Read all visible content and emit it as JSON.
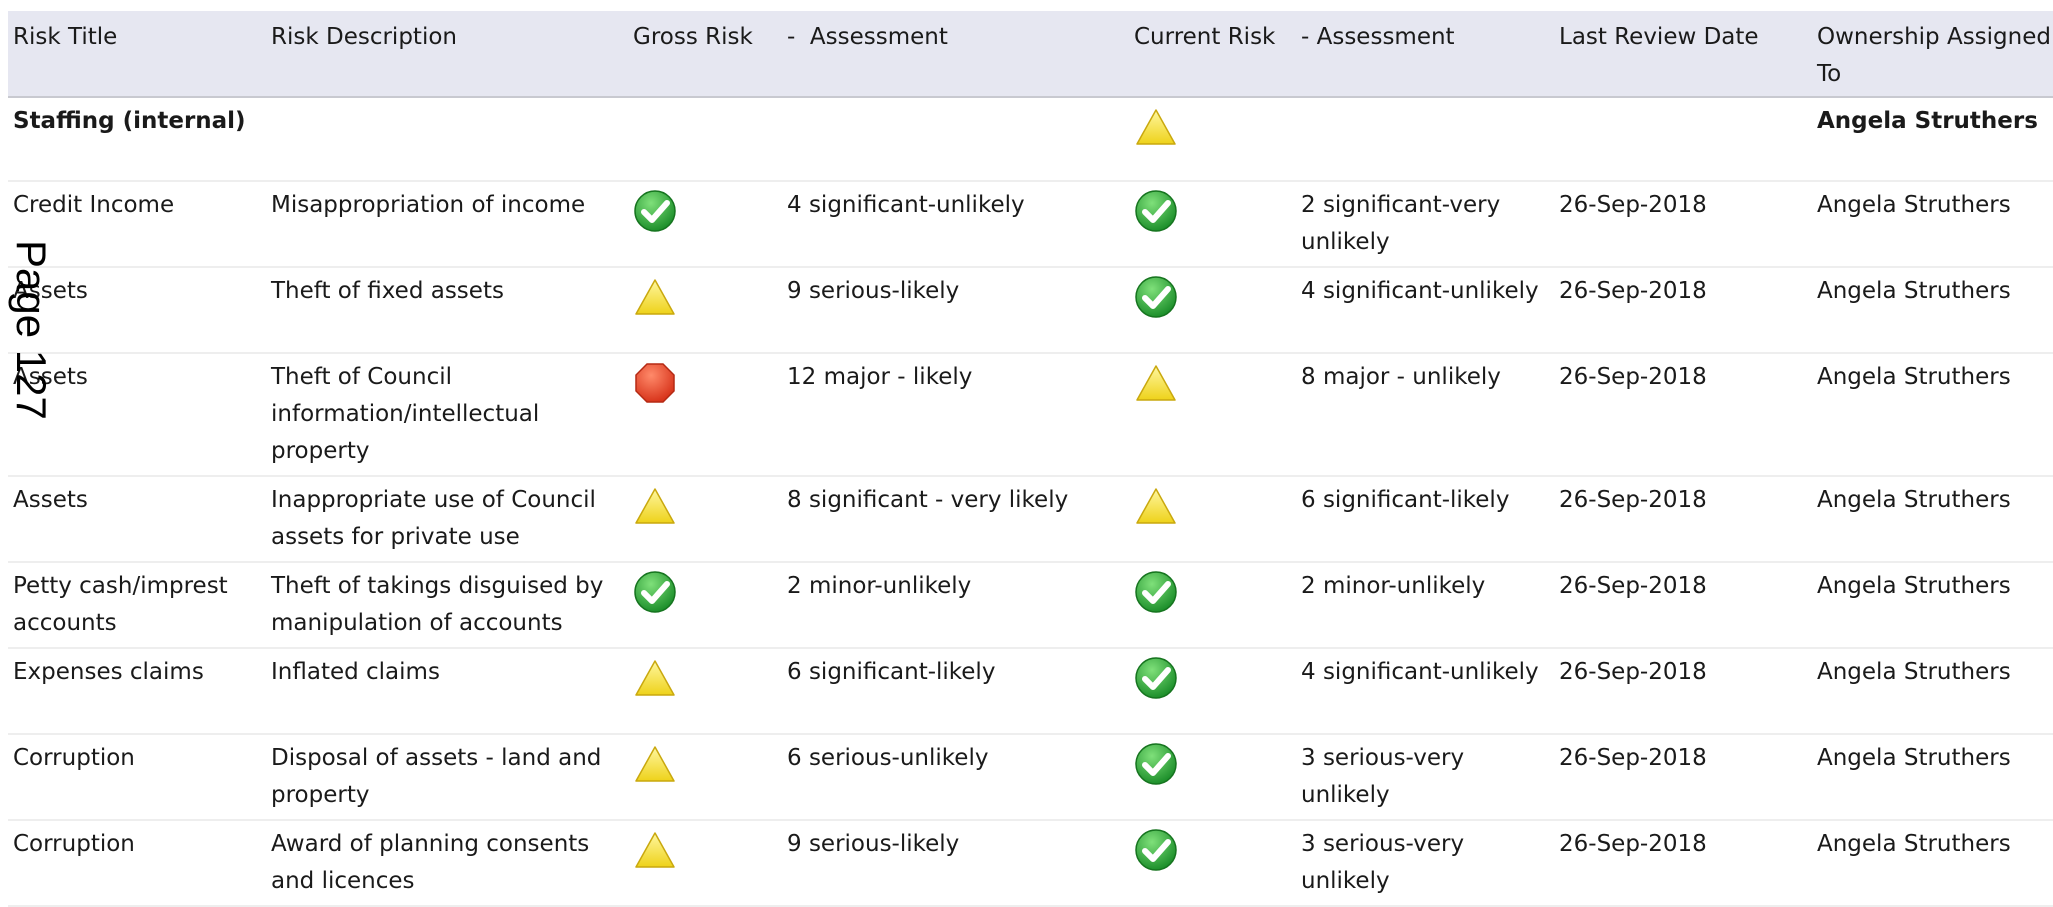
{
  "table": {
    "headers": {
      "risk_title": "Risk Title",
      "risk_description": "Risk Description",
      "gross_risk": "Gross Risk",
      "gross_assessment": "-  Assessment",
      "current_risk": "Current Risk",
      "current_assessment": "- Assessment",
      "last_review": "Last Review Date",
      "ownership": "Ownership Assigned To"
    },
    "group": {
      "title": "Staffing (internal)",
      "current_icon": "warning-triangle-icon",
      "owner": "Angela Struthers"
    },
    "rows": [
      {
        "title": "Credit Income",
        "description": "Misappropriation of income",
        "gross_icon": "check-icon",
        "gross_assessment": "4 significant-unlikely",
        "current_icon": "check-icon",
        "current_assessment": "2 significant-very unlikely",
        "date": "26-Sep-2018",
        "owner": "Angela Struthers"
      },
      {
        "title": "Assets",
        "description": "Theft of fixed assets",
        "gross_icon": "warning-triangle-icon",
        "gross_assessment": "9 serious-likely",
        "current_icon": "check-icon",
        "current_assessment": "4 significant-unlikely",
        "date": "26-Sep-2018",
        "owner": "Angela Struthers"
      },
      {
        "title": "Assets",
        "description": "Theft of Council information/intellectual property",
        "gross_icon": "stop-octagon-icon",
        "gross_assessment": "12 major - likely",
        "current_icon": "warning-triangle-icon",
        "current_assessment": "8 major - unlikely",
        "date": "26-Sep-2018",
        "owner": "Angela Struthers"
      },
      {
        "title": "Assets",
        "description": "Inappropriate use of Council assets for private use",
        "gross_icon": "warning-triangle-icon",
        "gross_assessment": "8 significant - very likely",
        "current_icon": "warning-triangle-icon",
        "current_assessment": "6 significant-likely",
        "date": "26-Sep-2018",
        "owner": "Angela Struthers"
      },
      {
        "title": "Petty cash/imprest accounts",
        "description": "Theft of takings disguised by manipulation of accounts",
        "gross_icon": "check-icon",
        "gross_assessment": "2 minor-unlikely",
        "current_icon": "check-icon",
        "current_assessment": "2 minor-unlikely",
        "date": "26-Sep-2018",
        "owner": "Angela Struthers"
      },
      {
        "title": "Expenses claims",
        "description": "Inflated claims",
        "gross_icon": "warning-triangle-icon",
        "gross_assessment": "6 significant-likely",
        "current_icon": "check-icon",
        "current_assessment": "4 significant-unlikely",
        "date": "26-Sep-2018",
        "owner": "Angela Struthers"
      },
      {
        "title": "Corruption",
        "description": "Disposal of assets - land and property",
        "gross_icon": "warning-triangle-icon",
        "gross_assessment": "6 serious-unlikely",
        "current_icon": "check-icon",
        "current_assessment": "3 serious-very unlikely",
        "date": "26-Sep-2018",
        "owner": "Angela Struthers"
      },
      {
        "title": "Corruption",
        "description": "Award of planning consents and licences",
        "gross_icon": "warning-triangle-icon",
        "gross_assessment": "9 serious-likely",
        "current_icon": "check-icon",
        "current_assessment": "3 serious-very unlikely",
        "date": "26-Sep-2018",
        "owner": "Angela Struthers"
      }
    ]
  },
  "page_marker": "Page 127",
  "colors": {
    "header_bg": "#e6e7f1",
    "check_green": "#2ea83a",
    "warning_yellow": "#f3e226",
    "stop_red": "#e8452a"
  }
}
